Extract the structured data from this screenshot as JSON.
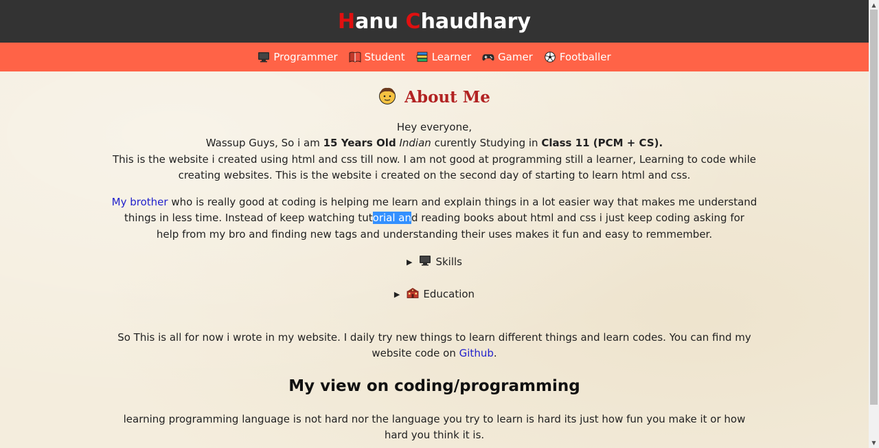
{
  "header": {
    "title_first_letter": "H",
    "title_first_rest": "anu ",
    "title_last_letter": "C",
    "title_last_rest": "haudhary"
  },
  "nav": {
    "items": [
      {
        "label": "Programmer",
        "icon": "monitor-icon"
      },
      {
        "label": "Student",
        "icon": "book-icon"
      },
      {
        "label": "Learner",
        "icon": "books-stack-icon"
      },
      {
        "label": "Gamer",
        "icon": "gamepad-icon"
      },
      {
        "label": "Footballer",
        "icon": "soccer-ball-icon"
      }
    ]
  },
  "about": {
    "heading": "About Me",
    "icon": "boy-face-icon",
    "p1": {
      "line1": "Hey everyone,",
      "l2_pre": "Wassup Guys, So i am ",
      "l2_bold1": "15 Years Old",
      "l2_italic": "Indian",
      "l2_mid": " curently Studying in ",
      "l2_bold2": "Class 11 (PCM + CS).",
      "l3": "This is the website i created using html and css till now. I am not good at programming still a learner, Learning to code while creating websites. This is the website i created on the second day of starting to learn html and css."
    },
    "p2": {
      "link": "My brother",
      "pre_sel": " who is really good at coding is helping me learn and explain things in a lot easier way that makes me understand things in less time. Instead of keep watching tut",
      "sel": "orial an",
      "post_sel": "d reading books about html and css i just keep coding asking for help from my bro and finding new tags and understanding their uses makes it fun and easy to remmember."
    }
  },
  "skills": {
    "label": "Skills",
    "icon": "monitor-icon"
  },
  "education": {
    "label": "Education",
    "icon": "school-icon"
  },
  "closing": {
    "pre": "So This is all for now i wrote in my website. I daily try new things to learn different things and learn codes. You can find my website code on ",
    "link": "Github",
    "post": "."
  },
  "view": {
    "heading": "My view on coding/programming",
    "text": "learning programming language is not hard nor the language you try to learn is hard its just how fun you make it or how hard you think it is."
  },
  "colors": {
    "header_bg": "#333333",
    "nav_bg": "#ff6347",
    "accent_red": "#e01010",
    "heading_red": "#b22222",
    "link": "#2222cc",
    "background": "#f4eddd"
  }
}
